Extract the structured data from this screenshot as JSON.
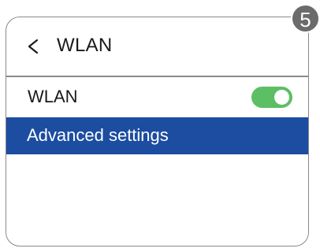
{
  "header": {
    "back_icon": "chevron-left-icon",
    "title": "WLAN"
  },
  "step_badge": {
    "number": "5"
  },
  "settings": {
    "wlan": {
      "label": "WLAN",
      "enabled": true,
      "toggle_color": "#5cbf63"
    },
    "advanced": {
      "label": "Advanced settings",
      "selected": true,
      "highlight_color": "#1c4da1"
    }
  }
}
